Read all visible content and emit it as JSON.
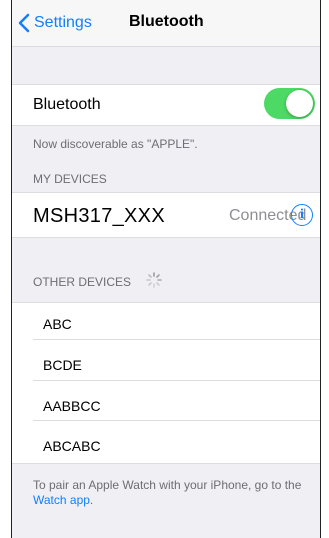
{
  "nav": {
    "back_label": "Settings",
    "title": "Bluetooth"
  },
  "bluetooth": {
    "label": "Bluetooth",
    "enabled": true,
    "discoverable_text": "Now discoverable as \"APPLE\"."
  },
  "my_devices": {
    "header": "MY DEVICES",
    "items": [
      {
        "name": "MSH317_XXX",
        "status": "Connected",
        "info_icon": "i"
      }
    ]
  },
  "other_devices": {
    "header": "OTHER DEVICES",
    "items": [
      {
        "name": "ABC"
      },
      {
        "name": "BCDE"
      },
      {
        "name": "AABBCC"
      },
      {
        "name": "ABCABC"
      }
    ]
  },
  "footer": {
    "text": "To pair an Apple Watch with your iPhone, go to the",
    "link": "Watch app",
    "suffix": "."
  },
  "colors": {
    "accent": "#147efb",
    "toggle_on": "#4cd964",
    "background": "#efeff4"
  }
}
